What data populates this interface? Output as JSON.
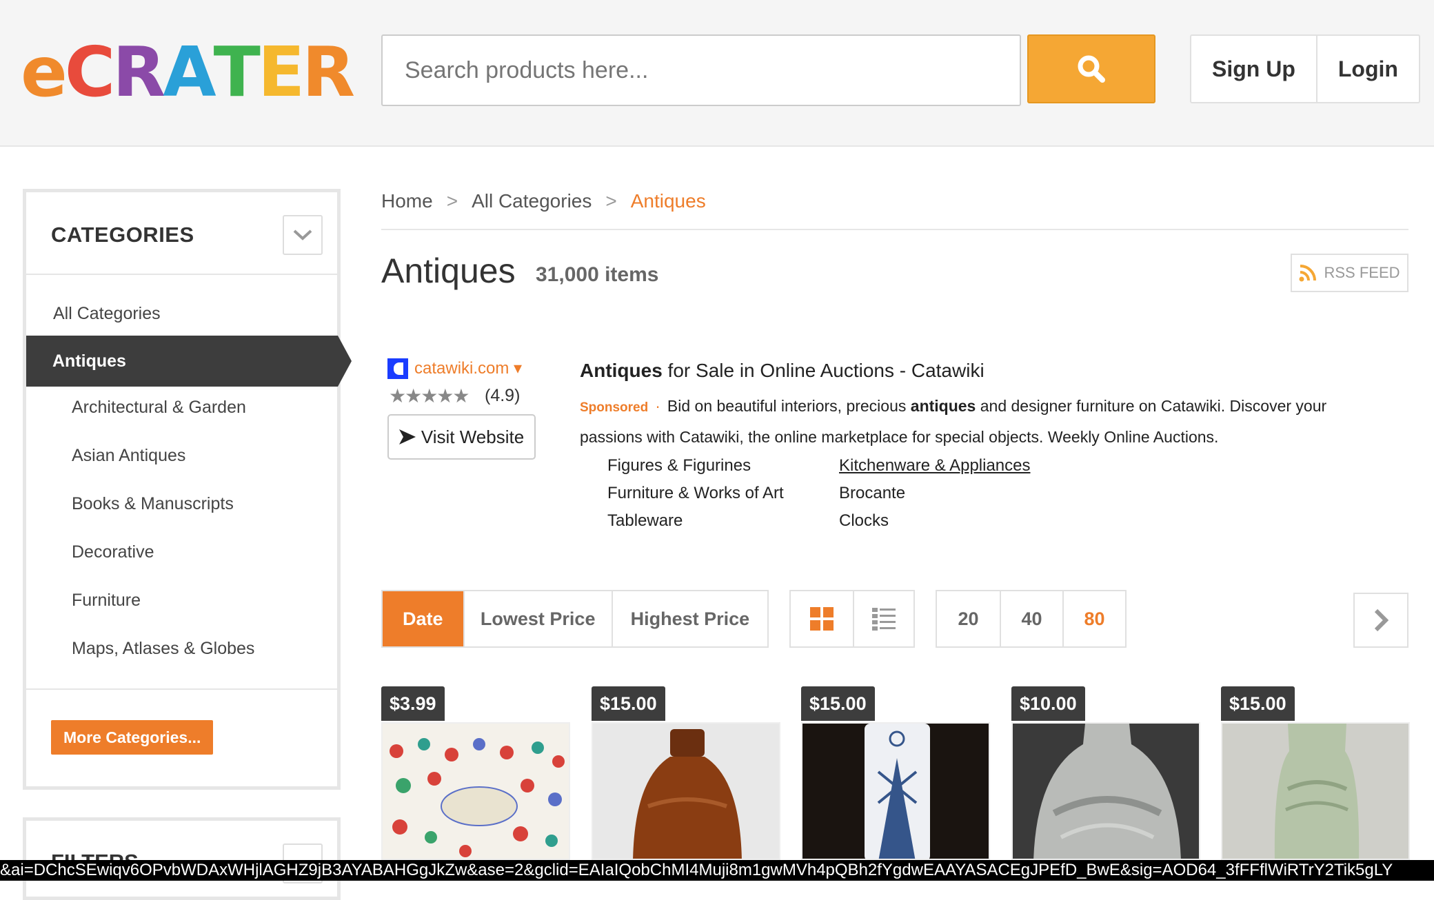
{
  "header": {
    "logo_letters": [
      "e",
      "C",
      "R",
      "A",
      "T",
      "E",
      "R"
    ],
    "search_placeholder": "Search products here...",
    "sign_up": "Sign Up",
    "login": "Login"
  },
  "sidebar": {
    "categories_title": "CATEGORIES",
    "items": [
      {
        "label": "All Categories"
      },
      {
        "label": "Antiques"
      },
      {
        "label": "Architectural & Garden"
      },
      {
        "label": "Asian Antiques"
      },
      {
        "label": "Books & Manuscripts"
      },
      {
        "label": "Decorative"
      },
      {
        "label": "Furniture"
      },
      {
        "label": "Maps, Atlases & Globes"
      }
    ],
    "more_button": "More Categories...",
    "filters_title": "FILTERS"
  },
  "breadcrumb": {
    "home": "Home",
    "sep": ">",
    "all": "All Categories",
    "current": "Antiques"
  },
  "page": {
    "title": "Antiques",
    "count": "31,000 items",
    "rss": "RSS FEED"
  },
  "ad": {
    "domain": "catawiki.com ▾",
    "stars": "★★★★★",
    "rating": "(4.9)",
    "visit": "Visit Website",
    "headline_bold": "Antiques",
    "headline_rest": " for Sale in Online Auctions - Catawiki",
    "sponsored": "Sponsored",
    "dot": "·",
    "desc_1": "Bid on beautiful interiors, precious ",
    "desc_bold": "antiques",
    "desc_2": " and designer furniture on Catawiki. Discover your passions with Catawiki, the online marketplace for special objects. Weekly Online Auctions.",
    "links": [
      "Figures & Figurines",
      "Kitchenware & Appliances",
      "Furniture & Works of Art",
      "Brocante",
      "Tableware",
      "Clocks"
    ]
  },
  "sort": {
    "options": [
      "Date",
      "Lowest Price",
      "Highest Price"
    ],
    "per_page": [
      "20",
      "40",
      "80"
    ]
  },
  "products": [
    {
      "price": "$3.99"
    },
    {
      "price": "$15.00"
    },
    {
      "price": "$15.00"
    },
    {
      "price": "$10.00"
    },
    {
      "price": "$15.00"
    }
  ],
  "status_url": "&ai=DChcSEwiqv6OPvbWDAxWHjlAGHZ9jB3AYABAHGgJkZw&ase=2&gclid=EAIaIQobChMI4Muji8m1gwMVh4pQBh2fYgdwEAAYASACEgJPEfD_BwE&sig=AOD64_3fFFflWiRTrY2Tik5gLY",
  "colors": {
    "accent": "#ee7d2a",
    "search_button": "#f5a734",
    "dark": "#3d3d3d",
    "logo": [
      "#f08a2c",
      "#e84b3c",
      "#8b4aa8",
      "#2aa0d8",
      "#3fb34f",
      "#f5b82e",
      "#f08a2c"
    ]
  }
}
